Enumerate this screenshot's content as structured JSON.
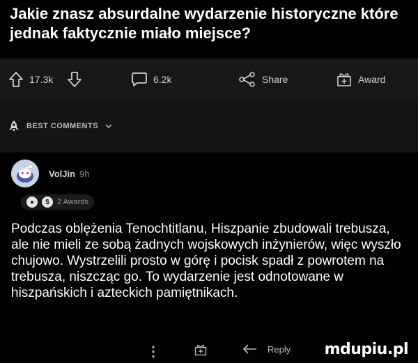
{
  "post": {
    "title": "Jakie znasz absurdalne wydarzenie historyczne które jednak faktycznie miało miejsce?"
  },
  "actions": {
    "upvotes": "17.3k",
    "comments": "6.2k",
    "share_label": "Share",
    "award_label": "Award"
  },
  "sort": {
    "label": "BEST COMMENTS"
  },
  "comment": {
    "author": "VolJin",
    "time": "9h",
    "awards": "2 Awards",
    "body": "Podczas oblężenia Tenochtitlanu, Hiszpanie zbudowali trebusza, ale nie mieli ze sobą żadnych wojskowych inżynierów, więc wyszło chujowo. Wystrzelili prosto w górę i pocisk spadł z powrotem na trebusza, niszcząc go. To wydarzenie jest odnotowane w hiszpańskich i azteckich pamiętnikach.",
    "reply_label": "Reply"
  },
  "watermark": "mdupiu.pl"
}
